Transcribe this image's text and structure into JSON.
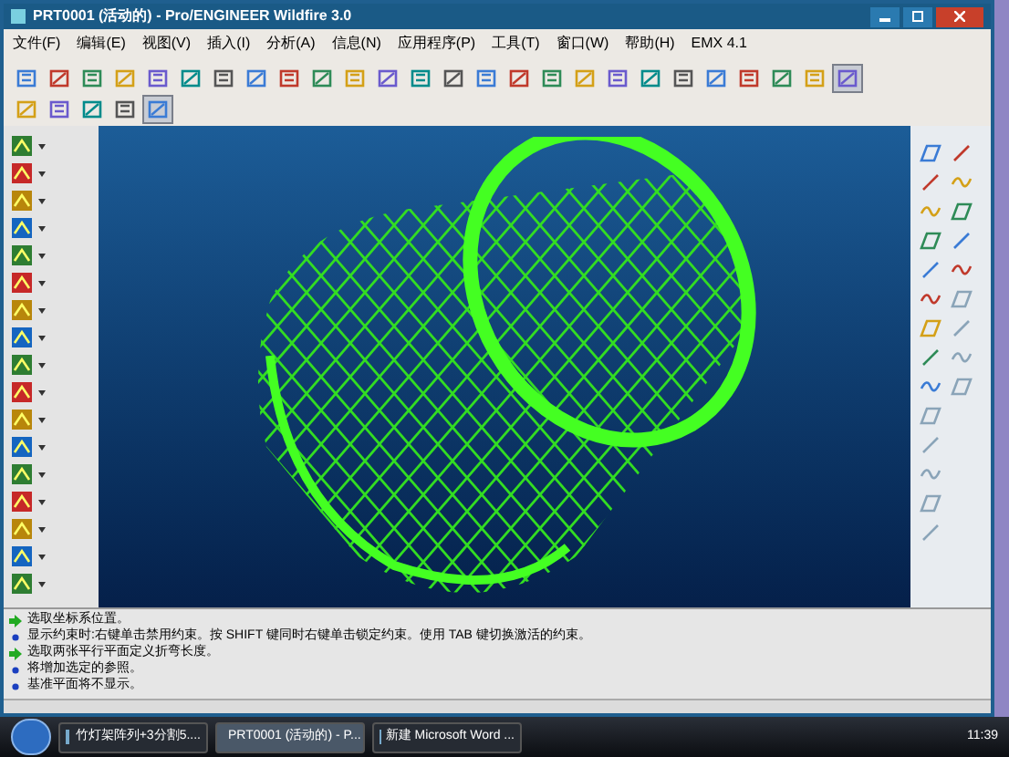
{
  "window": {
    "title": "PRT0001 (活动的) - Pro/ENGINEER Wildfire 3.0"
  },
  "menu": [
    "文件(F)",
    "编辑(E)",
    "视图(V)",
    "插入(I)",
    "分析(A)",
    "信息(N)",
    "应用程序(P)",
    "工具(T)",
    "窗口(W)",
    "帮助(H)",
    "EMX 4.1"
  ],
  "toolbar_rows": [
    [
      {
        "selected": false
      },
      {
        "selected": false
      },
      {
        "selected": false
      },
      {
        "selected": false
      },
      {
        "selected": false
      },
      {
        "selected": false
      },
      {
        "selected": false
      },
      {
        "selected": false
      },
      {
        "selected": false
      },
      {
        "selected": false
      },
      {
        "selected": false
      },
      {
        "selected": false
      },
      {
        "selected": false
      },
      {
        "selected": false
      },
      {
        "selected": false
      },
      {
        "selected": false
      },
      {
        "selected": false
      },
      {
        "selected": false
      },
      {
        "selected": false
      },
      {
        "selected": false
      },
      {
        "selected": false
      },
      {
        "selected": false
      },
      {
        "selected": false
      },
      {
        "selected": false
      },
      {
        "selected": false
      },
      {
        "selected": true
      }
    ],
    [
      {
        "selected": false
      },
      {
        "selected": false
      },
      {
        "selected": false
      },
      {
        "selected": false
      },
      {
        "selected": true
      }
    ]
  ],
  "messages": [
    {
      "kind": "prompt",
      "text": "选取坐标系位置。"
    },
    {
      "kind": "info",
      "text": "显示约束时:右键单击禁用约束。按 SHIFT 键同时右键单击锁定约束。使用 TAB 键切换激活的约束。"
    },
    {
      "kind": "prompt",
      "text": "选取两张平行平面定义折弯长度。"
    },
    {
      "kind": "info",
      "text": "将增加选定的参照。"
    },
    {
      "kind": "info",
      "text": "基准平面将不显示。"
    }
  ],
  "taskbar": {
    "tasks": [
      {
        "label": "竹灯架阵列+3分割5....",
        "selected": false
      },
      {
        "label": "PRT0001 (活动的) - P...",
        "selected": true
      },
      {
        "label": "新建 Microsoft Word ...",
        "selected": false
      }
    ],
    "clock": "11:39"
  }
}
